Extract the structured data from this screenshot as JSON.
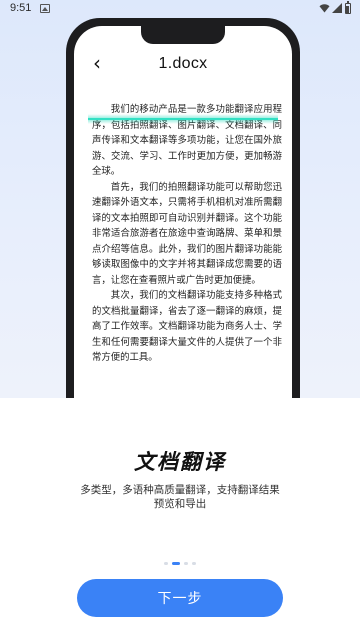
{
  "status_bar": {
    "time": "9:51",
    "icons": [
      "image-notification-icon",
      "wifi-icon",
      "signal-icon",
      "battery-icon"
    ]
  },
  "preview": {
    "doc_title": "1.docx",
    "back_icon": "chevron-left-icon",
    "paragraphs": [
      "我们的移动产品是一款多功能翻译应用程序，包括拍照翻译、图片翻译、文档翻译、同声传译和文本翻译等多项功能，让您在国外旅游、交流、学习、工作时更加方便，更加畅游全球。",
      "首先，我们的拍照翻译功能可以帮助您迅速翻译外语文本，只需将手机相机对准所需翻译的文本拍照即可自动识别并翻译。这个功能非常适合旅游者在旅途中查询路牌、菜单和景点介绍等信息。此外，我们的图片翻译功能能够读取图像中的文字并将其翻译成您需要的语言，让您在查看照片或广告时更加便捷。",
      "其次，我们的文档翻译功能支持多种格式的文档批量翻译，省去了逐一翻译的麻烦，提高了工作效率。文档翻译功能为商务人士、学生和任何需要翻译大量文件的人提供了一个非常方便的工具。"
    ]
  },
  "onboarding": {
    "headline": "文档翻译",
    "subtitle": "多类型，多语种高质量翻译，支持翻译结果预览和导出",
    "page_count": 4,
    "active_page": 2,
    "next_label": "下一步"
  },
  "colors": {
    "accent": "#3a82f6",
    "hero_bg": "#dde8fb",
    "scan_line": "#33e0c4"
  }
}
